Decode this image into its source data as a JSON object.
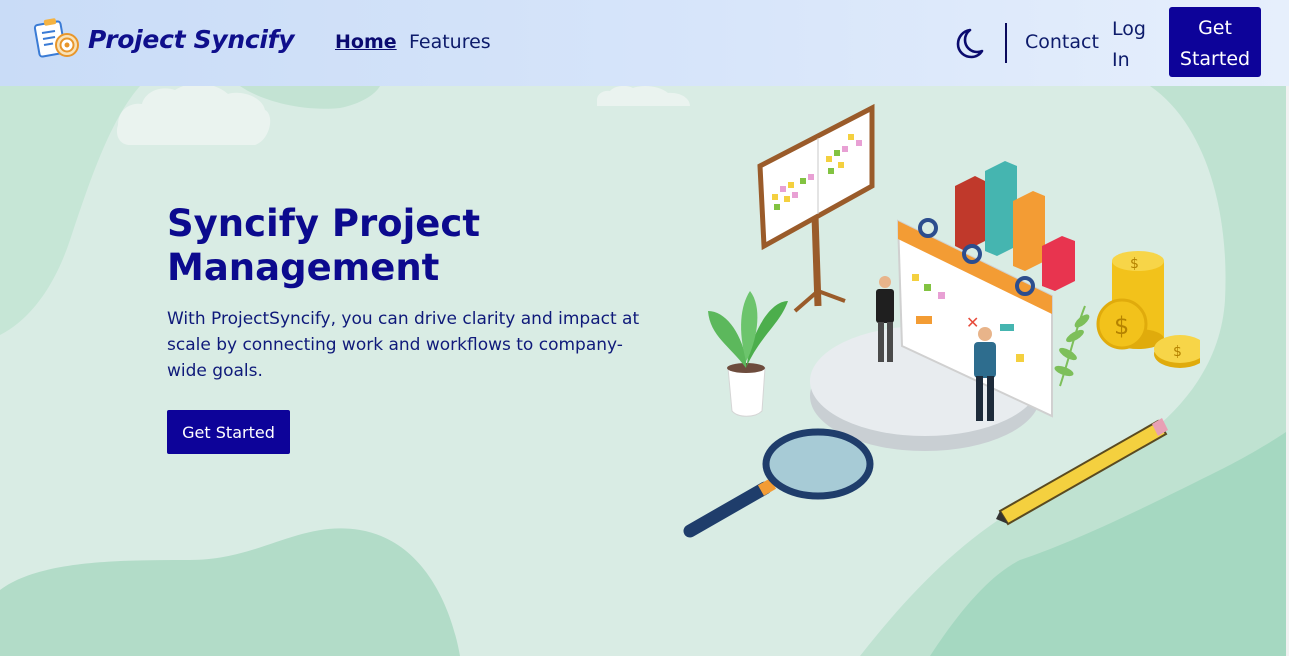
{
  "navbar": {
    "brand": "Project Syncify",
    "logo_icon": "clipboard-target-icon",
    "links": [
      {
        "label": "Home",
        "active": true
      },
      {
        "label": "Features",
        "active": false
      }
    ],
    "theme_toggle_icon": "moon-icon",
    "contact_label": "Contact",
    "login_label": "Log In",
    "cta_label": "Get Started"
  },
  "hero": {
    "title": "Syncify Project Management",
    "description": "With ProjectSyncify, you can drive clarity and impact at scale by connecting work and workflows to company-wide goals.",
    "cta_label": "Get Started"
  },
  "illustration": {
    "subject": "project-management-isometric-illustration"
  },
  "colors": {
    "primary": "#0d0399",
    "heading": "#0c0a8e",
    "background": "#d9ece4",
    "navbar": "#d7e5fa"
  }
}
